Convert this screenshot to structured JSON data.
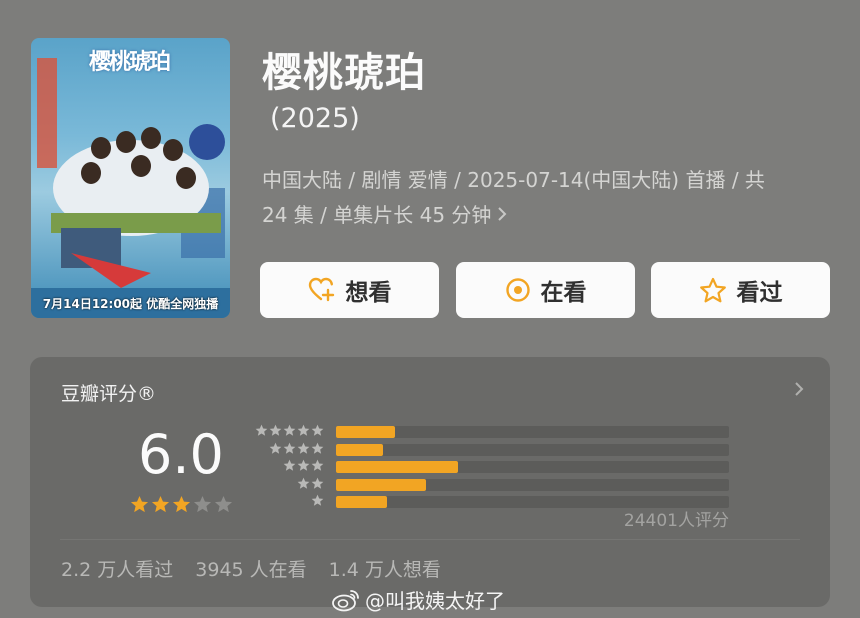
{
  "poster": {
    "title_art": "樱桃琥珀",
    "caption": "7月14日12:00起 优酷全网独播"
  },
  "title": "樱桃琥珀",
  "year": "(2025)",
  "meta": {
    "line1": "中国大陆 / 剧情 爱情 / 2025-07-14(中国大陆) 首播 / 共",
    "line2": "24 集 / 单集片长 45 分钟"
  },
  "actions": [
    {
      "label": "想看",
      "icon": "heart-plus-icon"
    },
    {
      "label": "在看",
      "icon": "target-circle-icon"
    },
    {
      "label": "看过",
      "icon": "star-outline-icon"
    }
  ],
  "rating": {
    "label": "豆瓣评分®",
    "score": "6.0",
    "stars_filled": 3,
    "stars_total": 5,
    "count_text": "24401人评分",
    "distribution": [
      {
        "stars": 5,
        "fraction": 0.15
      },
      {
        "stars": 4,
        "fraction": 0.12
      },
      {
        "stars": 3,
        "fraction": 0.31
      },
      {
        "stars": 2,
        "fraction": 0.23
      },
      {
        "stars": 1,
        "fraction": 0.13
      }
    ],
    "colors": {
      "accent": "#f2a523",
      "star_empty": "#8e8e8c"
    }
  },
  "stats": {
    "watched": "2.2 万人看过",
    "watching": "3945 人在看",
    "want": "1.4 万人想看"
  },
  "watermark": "@叫我姨太好了"
}
